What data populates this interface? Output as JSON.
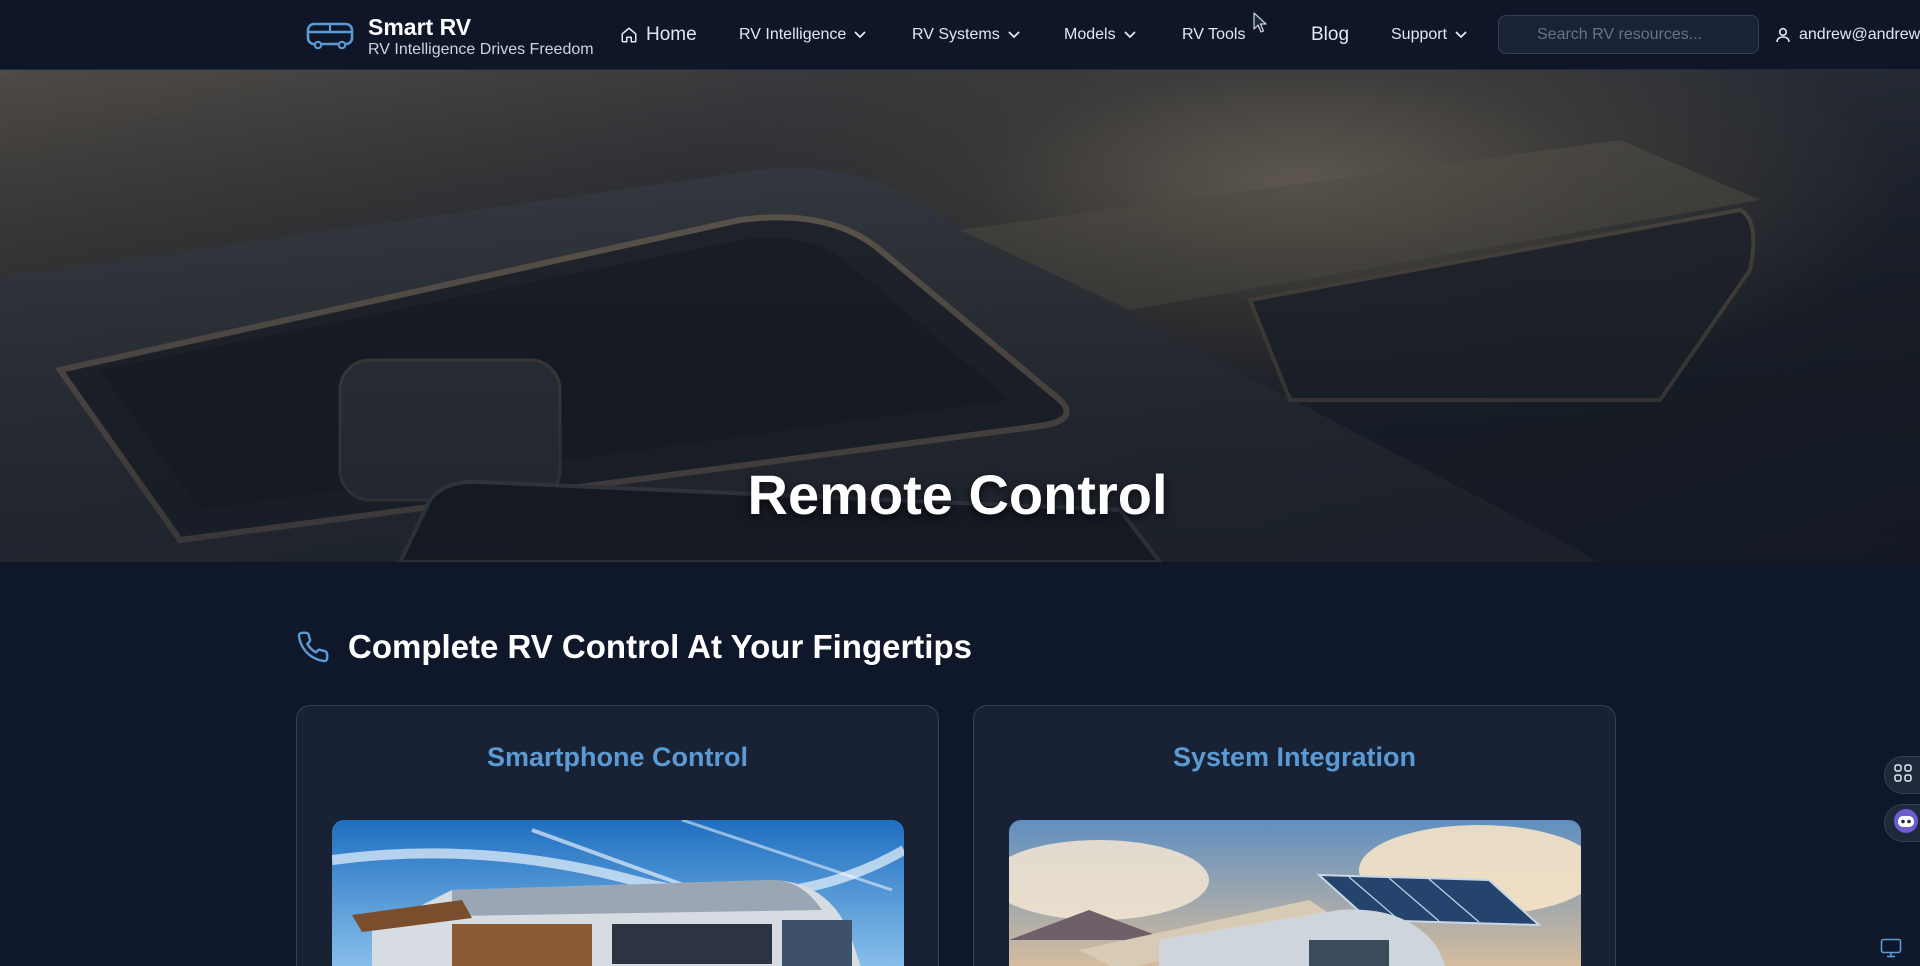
{
  "brand": {
    "title": "Smart RV",
    "tagline": "RV Intelligence Drives Freedom"
  },
  "nav": {
    "home": "Home",
    "rv_intelligence": "RV Intelligence",
    "rv_systems": "RV Systems",
    "models": "Models",
    "rv_tools": "RV Tools",
    "blog": "Blog",
    "support": "Support"
  },
  "search": {
    "placeholder": "Search RV resources...",
    "value": ""
  },
  "user": {
    "email": "andrew@andrew"
  },
  "hero": {
    "title": "Remote Control"
  },
  "section": {
    "title": "Complete RV Control At Your Fingertips"
  },
  "cards": [
    {
      "title": "Smartphone Control"
    },
    {
      "title": "System Integration"
    }
  ],
  "colors": {
    "accent": "#5b9bd5",
    "background": "#0f172a",
    "navbar": "#0e1628",
    "card": "#192234"
  },
  "icons": {
    "logo": "bus-icon",
    "home": "home-icon",
    "chevron": "chevron-down-icon",
    "user": "user-icon",
    "phone": "phone-icon",
    "apps": "apps-icon",
    "assistant": "robot-icon",
    "monitor": "monitor-icon"
  }
}
